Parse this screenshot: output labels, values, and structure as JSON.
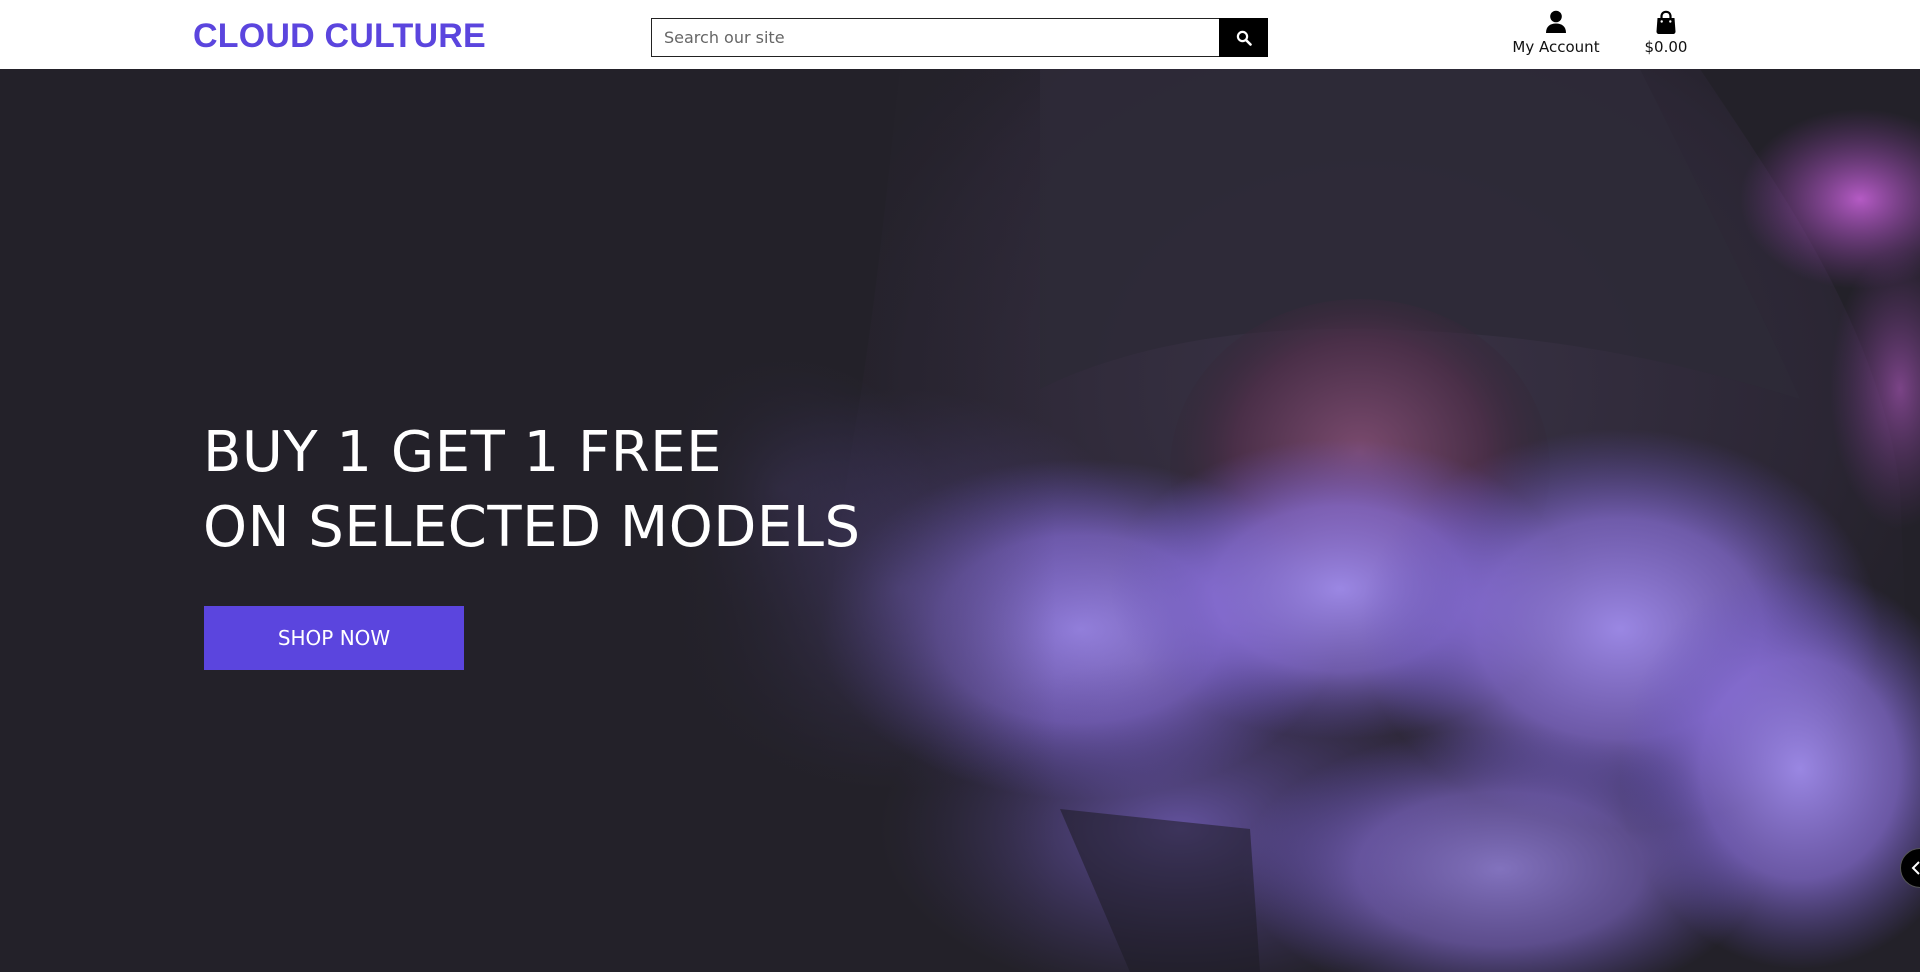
{
  "header": {
    "logo": "CLOUD CULTURE",
    "search": {
      "placeholder": "Search our site",
      "value": ""
    },
    "search_button_icon": "search-icon",
    "account": {
      "label": "My Account",
      "icon": "user-icon"
    },
    "cart": {
      "total": "$0.00",
      "icon": "shopping-bag-icon"
    }
  },
  "hero": {
    "headline_line1": "BUY 1 GET 1 FREE",
    "headline_line2": "ON SELECTED MODELS",
    "cta_label": "SHOP NOW",
    "side_arrow_icon": "chevron-left-icon"
  },
  "colors": {
    "brand": "#5b45de",
    "hero_bg": "#232129",
    "smoke": "#9b84e6",
    "header_bg": "#ffffff"
  }
}
